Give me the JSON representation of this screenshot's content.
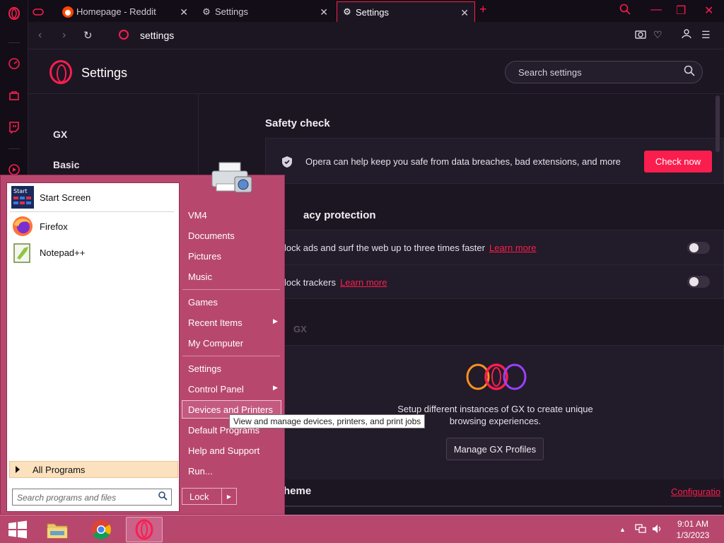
{
  "tabs": [
    {
      "title": "Homepage - Reddit",
      "active": false
    },
    {
      "title": "Settings",
      "active": false
    },
    {
      "title": "Settings",
      "active": true
    }
  ],
  "address": {
    "url": "settings"
  },
  "settings": {
    "title": "Settings",
    "search_placeholder": "Search settings",
    "nav": [
      "GX",
      "Basic"
    ],
    "safety": {
      "title": "Safety check",
      "text": "Opera can help keep you safe from data breaches, bad extensions, and more",
      "button": "Check now"
    },
    "privacy": {
      "title": "acy protection",
      "rows": [
        {
          "text": "lock ads and surf the web up to three times faster",
          "link": "Learn more"
        },
        {
          "text": "lock trackers",
          "link": "Learn more"
        }
      ]
    },
    "gx_section": {
      "label": "GX",
      "desc_line1": "Setup different instances of GX to create unique",
      "desc_line2": "browsing experiences.",
      "button": "Manage GX Profiles"
    },
    "theme": {
      "title": "heme",
      "link": "Configuratio"
    }
  },
  "start_menu": {
    "pinned": [
      {
        "label": "Start Screen"
      },
      {
        "label": "Firefox"
      },
      {
        "label": "Notepad++"
      }
    ],
    "all_programs": "All Programs",
    "search_placeholder": "Search programs and files",
    "right_items": [
      "VM4",
      "Documents",
      "Pictures",
      "Music",
      "Games",
      "Recent Items",
      "My Computer",
      "Settings",
      "Control Panel",
      "Devices and Printers",
      "Default Programs",
      "Help and Support",
      "Run..."
    ],
    "lock": "Lock",
    "tooltip": "View and manage devices, printers, and print jobs"
  },
  "taskbar": {
    "time": "9:01 AM",
    "date": "1/3/2023"
  },
  "colors": {
    "accent": "#fa1e4e",
    "start_bg": "#b8476e",
    "page_bg": "#1c1622"
  }
}
